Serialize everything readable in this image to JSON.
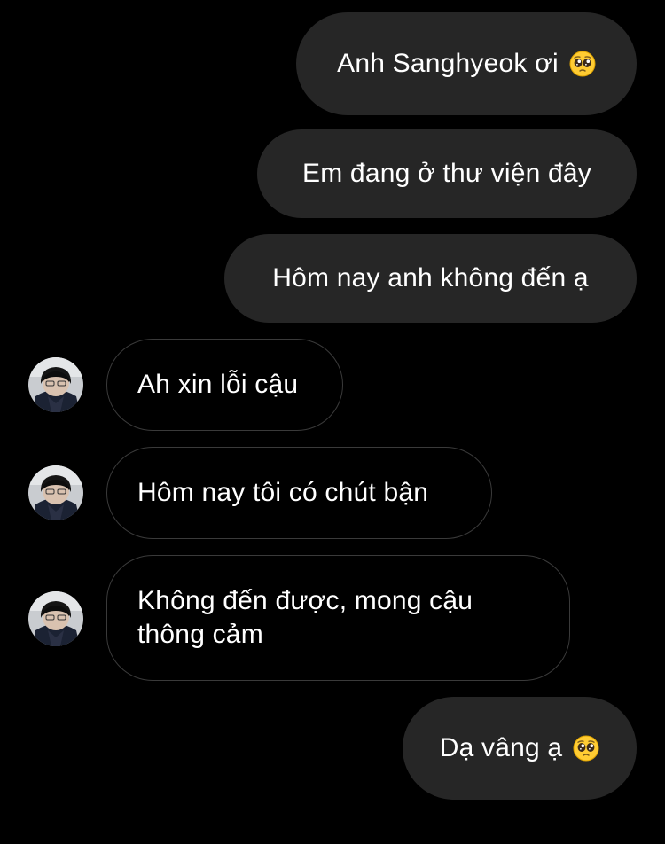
{
  "conversation": {
    "messages": [
      {
        "direction": "outgoing",
        "text": "Anh Sanghyeok ơi",
        "emoji": "pleading-face-icon"
      },
      {
        "direction": "outgoing",
        "text": "Em đang ở thư viện đây"
      },
      {
        "direction": "outgoing",
        "text": "Hôm nay anh không đến ạ"
      },
      {
        "direction": "incoming",
        "text": "Ah xin lỗi cậu"
      },
      {
        "direction": "incoming",
        "text": "Hôm nay tôi có chút bận"
      },
      {
        "direction": "incoming",
        "text": "Không đến được, mong cậu thông cảm"
      },
      {
        "direction": "outgoing",
        "text": "Dạ vâng ạ",
        "emoji": "pleading-face-icon"
      }
    ]
  },
  "colors": {
    "background": "#000000",
    "outgoing_bubble": "#262626",
    "incoming_border": "#3a3a3a",
    "text": "#ffffff"
  }
}
